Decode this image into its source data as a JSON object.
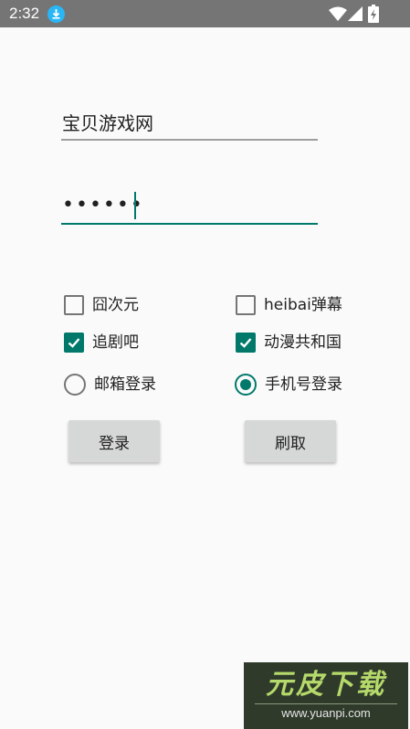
{
  "status_bar": {
    "time": "2:32",
    "icons": [
      "download-icon",
      "wifi-icon",
      "signal-icon",
      "battery-charging-icon"
    ]
  },
  "form": {
    "username_value": "宝贝游戏网",
    "password_masked": "••••••"
  },
  "options": {
    "opt1": {
      "label": "囧次元",
      "checked": false
    },
    "opt2": {
      "label": "heibai弹幕",
      "checked": false
    },
    "opt3": {
      "label": "追剧吧",
      "checked": true
    },
    "opt4": {
      "label": "动漫共和国",
      "checked": true
    },
    "radio1": {
      "label": "邮箱登录",
      "selected": false
    },
    "radio2": {
      "label": "手机号登录",
      "selected": true
    }
  },
  "buttons": {
    "login": "登录",
    "refresh": "刷取"
  },
  "watermark": {
    "title": "元皮下载",
    "url": "www.yuanpi.com"
  },
  "colors": {
    "accent": "#00796b",
    "status_bar": "#757575",
    "background": "#fafafa",
    "button": "#d6d7d7"
  }
}
